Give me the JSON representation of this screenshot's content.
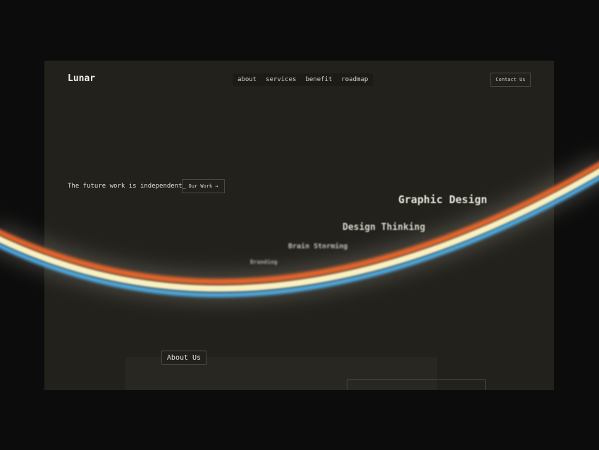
{
  "brand": {
    "logo": "Lunar"
  },
  "nav": {
    "items": [
      "about",
      "services",
      "benefit",
      "roadmap"
    ]
  },
  "header": {
    "contact_label": "Contact Us"
  },
  "hero": {
    "tagline": "The future work is independent_",
    "cta_label": "Our Work",
    "cta_arrow": "→"
  },
  "floating_words": [
    "Graphic Design",
    "Design Thinking",
    "Brain Storming",
    "Branding"
  ],
  "about": {
    "label": "About Us"
  },
  "colors": {
    "background": "#0c0c0c",
    "panel": "#22211c",
    "text": "#e2dfd4",
    "arc_orange": "#e8652a",
    "arc_cream": "#fbf0c0",
    "arc_blue": "#4fb4f0"
  }
}
